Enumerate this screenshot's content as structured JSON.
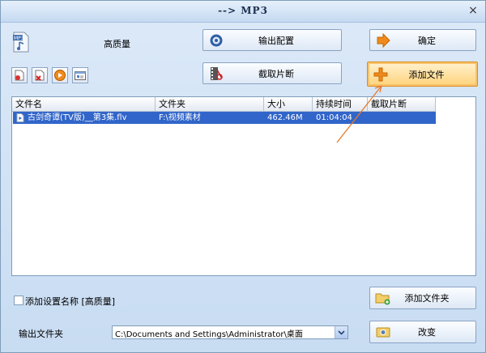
{
  "window": {
    "title": "--> MP3",
    "close": "×"
  },
  "profile": {
    "quality": "高质量"
  },
  "buttons": {
    "output_config": "输出配置",
    "ok": "确定",
    "clip": "截取片断",
    "add_file": "添加文件",
    "add_folder": "添加文件夹",
    "change": "改变"
  },
  "table": {
    "headers": [
      "文件名",
      "文件夹",
      "大小",
      "持续时间",
      "截取片断"
    ],
    "rows": [
      {
        "name": "古剑奇谭(TV版)__第3集.flv",
        "folder": "F:\\视频素材",
        "size": "462.46M",
        "duration": "01:04:04",
        "clip": ""
      }
    ]
  },
  "options": {
    "add_setting_name": "添加设置名称 [高质量]"
  },
  "output": {
    "label": "输出文件夹",
    "path": "C:\\Documents and Settings\\Administrator\\桌面"
  },
  "colors": {
    "selection": "#3165c9",
    "highlight": "#ffd27a",
    "annotation_arrow": "#e87a2a"
  }
}
